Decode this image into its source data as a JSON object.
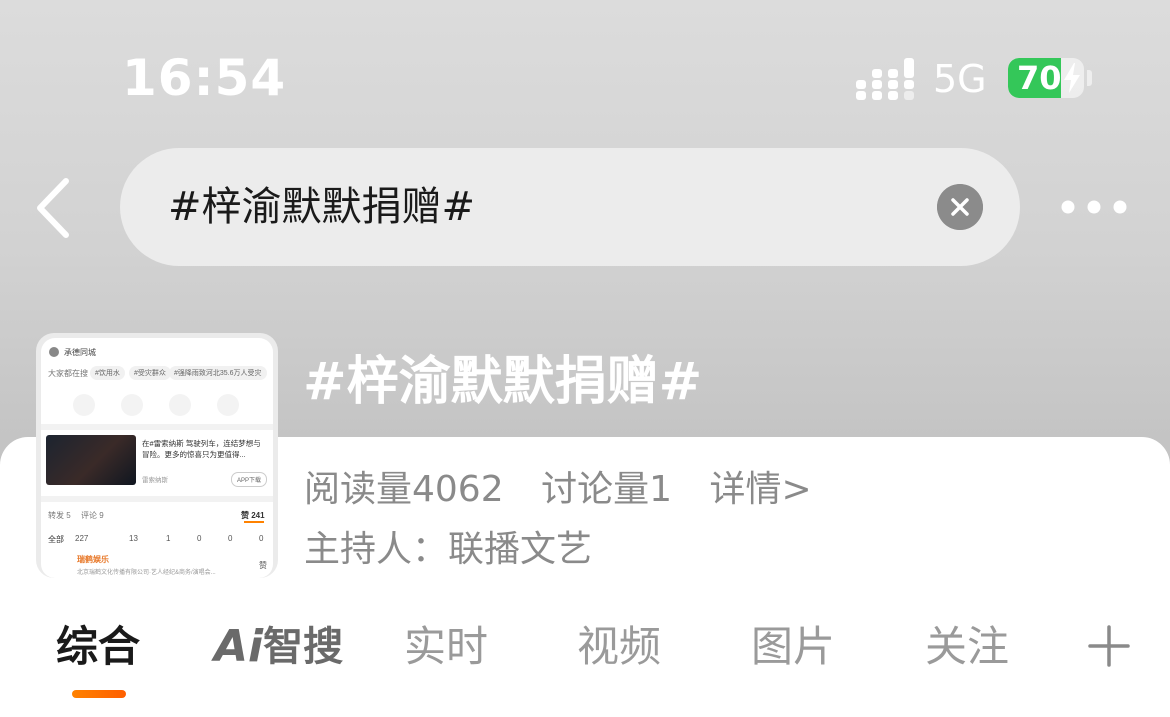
{
  "status_bar": {
    "time": "16:54",
    "network": "5G",
    "battery_level": "70",
    "battery_fraction": 0.7,
    "signal_bars_active": 4
  },
  "nav": {
    "search_query": "#梓渝默默捐赠#",
    "icons": [
      "chevron-left-icon",
      "close-icon",
      "more-icon"
    ]
  },
  "topic": {
    "title": "#梓渝默默捐赠#",
    "stats": {
      "reads": "阅读量4062",
      "discussions": "讨论量1",
      "details_link": "详情>"
    },
    "host": "主持人：联播文艺",
    "thumbnail": {
      "header": "承德同城",
      "trending_label": "大家都在搜",
      "chips": [
        "#饮用水",
        "#受灾群众",
        "#强降雨致河北35.6万人受灾"
      ],
      "card_text": "在#雷索纳斯 驾驶列车，连结梦想与冒险。更多的惊喜只为更值得...",
      "card_source": "雷索纳斯",
      "card_button": "APP下载",
      "repost": "转发 5",
      "comments": "评论 9",
      "likes": "赞 241",
      "reactions_label": "全部",
      "reactions": [
        "227",
        "13",
        "1",
        "0",
        "0",
        "0"
      ],
      "commenter_name": "瑞鹤娱乐",
      "commenter_desc": "北京瑞鹤文化传播有限公司·艺人经纪&商务/演唱会...",
      "commenter_like": "赞"
    }
  },
  "tabs": {
    "all": "综合",
    "ai_mark": "Ai",
    "ai_label": "智搜",
    "realtime": "实时",
    "video": "视频",
    "images": "图片",
    "follow": "关注",
    "active_index": 0
  },
  "colors": {
    "accent": "#ff8200",
    "battery_green": "#34c759",
    "text_dark": "#1a1a1a",
    "text_muted": "#8a8a8a"
  }
}
